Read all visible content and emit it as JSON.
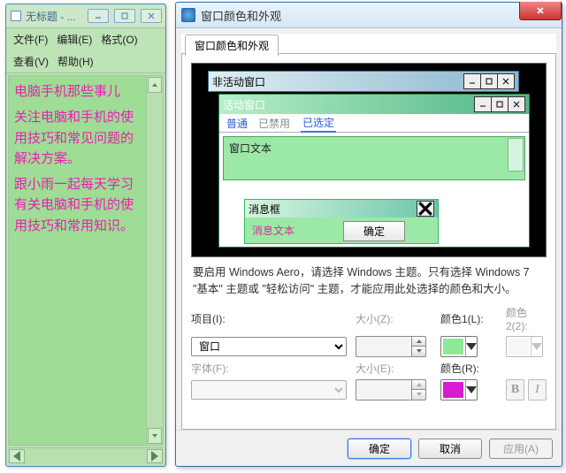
{
  "notepad": {
    "title": "无标题 - ...",
    "menu": {
      "file": "文件(F)",
      "edit": "编辑(E)",
      "format": "格式(O)",
      "view": "查看(V)",
      "help": "帮助(H)"
    },
    "content": {
      "p1": "电脑手机那些事儿",
      "p2": "关注电脑和手机的使用技巧和常见问题的解决方案。",
      "p3": "跟小雨一起每天学习有关电脑和手机的使用技巧和常用知识。"
    }
  },
  "dialog": {
    "title": "窗口颜色和外观",
    "tab": "窗口颜色和外观",
    "preview": {
      "inactive_title": "非活动窗口",
      "active_title": "活动窗口",
      "menu_normal": "普通",
      "menu_disabled": "已禁用",
      "menu_selected": "已选定",
      "window_text": "窗口文本",
      "msgbox_title": "消息框",
      "msgbox_text": "消息文本",
      "ok": "确定"
    },
    "note": "要启用 Windows Aero，请选择 Windows 主题。只有选择 Windows 7 \"基本\" 主题或 \"轻松访问\" 主题，才能应用此处选择的颜色和大小。",
    "labels": {
      "item": "项目(I):",
      "size1": "大小(Z):",
      "color1": "颜色1(L):",
      "color2": "颜色2(2):",
      "font": "字体(F):",
      "size2": "大小(E):",
      "colorR": "颜色(R):"
    },
    "values": {
      "item_selected": "窗口",
      "color1_hex": "#8de89a",
      "colorR_hex": "#d81bd0"
    },
    "buttons": {
      "ok": "确定",
      "cancel": "取消",
      "apply": "应用(A)"
    }
  }
}
